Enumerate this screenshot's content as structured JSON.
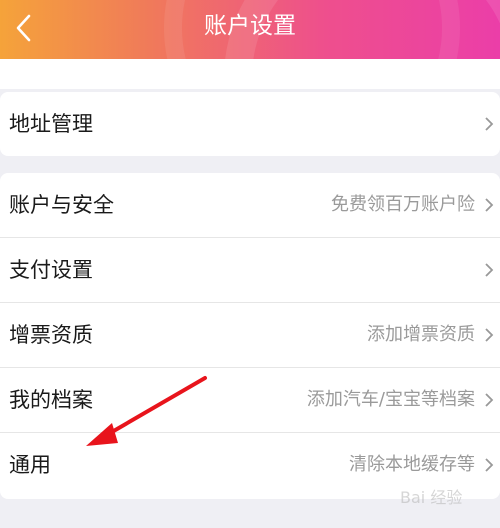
{
  "header": {
    "title": "账户设置",
    "back_icon": "chevron-left-icon",
    "gradient": [
      "#f5a33a",
      "#ee4f8d",
      "#eb3ea8"
    ]
  },
  "group1": {
    "rows": [
      {
        "label": "地址管理",
        "value": ""
      }
    ]
  },
  "group2": {
    "rows": [
      {
        "label": "账户与安全",
        "value": "免费领百万账户险"
      },
      {
        "label": "支付设置",
        "value": ""
      },
      {
        "label": "增票资质",
        "value": "添加增票资质"
      },
      {
        "label": "我的档案",
        "value": "添加汽车/宝宝等档案"
      },
      {
        "label": "通用",
        "value": "清除本地缓存等"
      }
    ]
  },
  "annotation": {
    "arrow_color": "#e8141c"
  },
  "watermark": {
    "text": "Bai 经验"
  }
}
